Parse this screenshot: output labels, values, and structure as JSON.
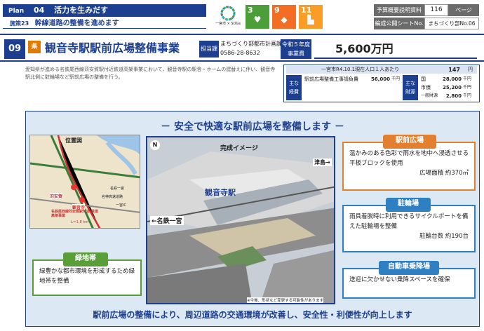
{
  "header": {
    "plan_label": "Plan",
    "plan_num": "04",
    "plan_title": "活力を生みだす",
    "policy_num": "施策23",
    "policy_title": "幹線道路の整備を進めます",
    "sdg_logo_text": "一宮市 × SDGs",
    "sdgs": [
      {
        "num": "3",
        "color": "#4c9f38"
      },
      {
        "num": "9",
        "color": "#f36d25"
      },
      {
        "num": "11",
        "color": "#f99d26"
      }
    ],
    "info": {
      "label1": "予算概要説明資料",
      "page": "116",
      "page_unit": "ページ",
      "label2": "編成公開シートNo.",
      "sheet_no": "まちづくり部No.06"
    }
  },
  "project": {
    "number": "09",
    "prefecture_mark": "県",
    "title": "観音寺駅駅前広場整備事業",
    "dept_label": "担当課",
    "dept": "まちづくり部都市計画課",
    "phone": "0586-28-8632",
    "budget_label": "令和５年度 事業費",
    "budget": "5,600万円"
  },
  "description": "愛知県が進める名鉄尾西線苅安賀駅付近鉄道高架事業において、観音寺駅の駅舎・ホームの建替えに伴い、観音寺駅北側に駐輪場など駅前広場の整備を行う。",
  "funding": {
    "population_line": "一宮市R4.10.1現在人口１人あたり",
    "population_value": "147",
    "population_unit": "円",
    "expense_tag": "主な 経費",
    "expense_item": "駅前広場整備工事請負費",
    "expense_value": "56,000",
    "unit": "千円",
    "source_tag": "主な 財源",
    "sources": [
      {
        "name": "国",
        "value": "28,000"
      },
      {
        "name": "市債",
        "value": "25,200"
      },
      {
        "name": "一般財源",
        "value": "2,800"
      }
    ]
  },
  "diagram": {
    "headline": "－ 安全で快適な駅前広場を整備します －",
    "map_title": "位置図",
    "map_labels": [
      "苅安賀",
      "観音寺",
      "名鉄尾西線苅安賀駅付近 鉄道高架事業",
      "L＝1.8 km",
      "名鉄一宮",
      "名神高速道路",
      "一宮IC"
    ],
    "photo_title": "完成イメージ",
    "station_label": "観音寺駅",
    "dir_north": "津島→",
    "dir_south": "←名鉄一宮",
    "photo_note": "※今後、形状など変更する可能性があります",
    "plaza": {
      "title": "駅前広場",
      "text": "温かみのある色彩で雨水を地中へ浸透させる平板ブロックを使用",
      "spec": "広場面積 約370㎡"
    },
    "bike": {
      "title": "駐輪場",
      "text": "雨具着脱時に利用できるサイクルポートを備えた駐輪場を整備",
      "spec": "駐輪台数 約190台"
    },
    "green": {
      "title": "緑地帯",
      "text": "緑豊かな都市環境を形成するため緑地帯を整備"
    },
    "drop": {
      "title": "自動車乗降場",
      "text": "送迎に欠かせない乗降スペースを確保"
    },
    "footer": "駅前広場の整備により、周辺道路の交通環境が改善し、安全性・利便性が向上します",
    "colors": {
      "orange": "#e2802f",
      "blue": "#2f7fc3",
      "green": "#5a9e3a",
      "navy": "#1d3f8f"
    }
  }
}
